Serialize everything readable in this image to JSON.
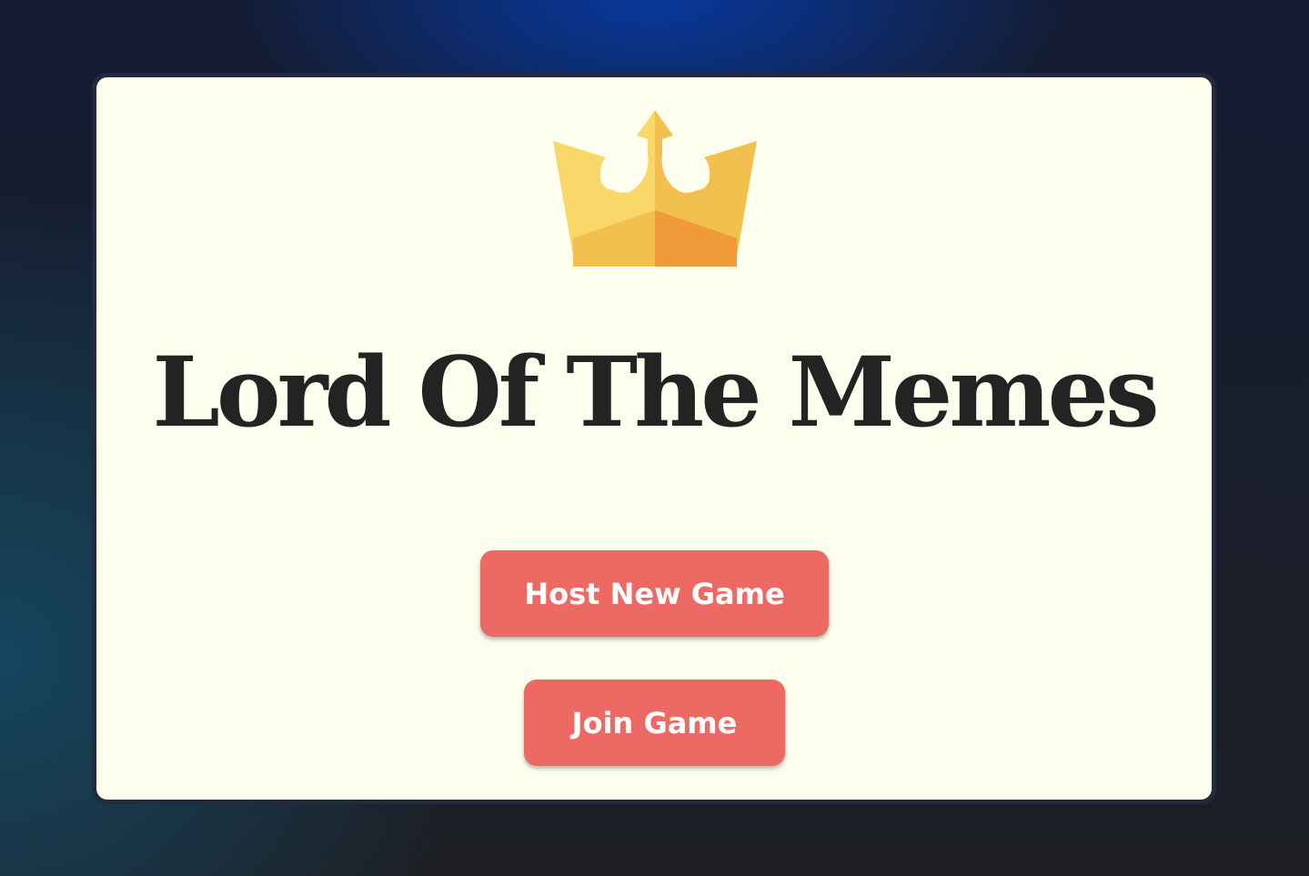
{
  "app": {
    "title": "Lord Of The Memes",
    "logo_icon": "crown-icon"
  },
  "actions": {
    "host_label": "Host New Game",
    "join_label": "Join Game"
  },
  "colors": {
    "background": "#1c1e23",
    "card": "#fdfeee",
    "button": "#ec6a63",
    "button_text": "#ffffff",
    "title_text": "#232323",
    "crown_gold": "#f2c04f"
  }
}
